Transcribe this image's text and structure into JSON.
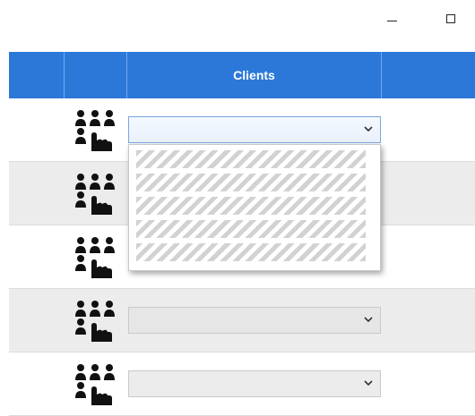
{
  "window": {
    "controls": [
      "minimize-icon",
      "maximize-icon"
    ]
  },
  "table": {
    "header": {
      "col_clients": "Clients"
    },
    "rows": [
      {
        "icon": "group-pointer-icon",
        "selected_value": "",
        "dropdown_open": true
      },
      {
        "icon": "group-pointer-icon",
        "selected_value": "",
        "dropdown_open": false
      },
      {
        "icon": "group-pointer-icon",
        "selected_value": "",
        "dropdown_open": false
      },
      {
        "icon": "group-pointer-icon",
        "selected_value": "",
        "dropdown_open": false
      },
      {
        "icon": "group-pointer-icon",
        "selected_value": "",
        "dropdown_open": false
      }
    ]
  },
  "dropdown": {
    "options": [
      "",
      "",
      "",
      "",
      ""
    ]
  },
  "colors": {
    "header_bg": "#2b78d9",
    "header_text": "#ffffff",
    "alt_row": "#ececec"
  }
}
